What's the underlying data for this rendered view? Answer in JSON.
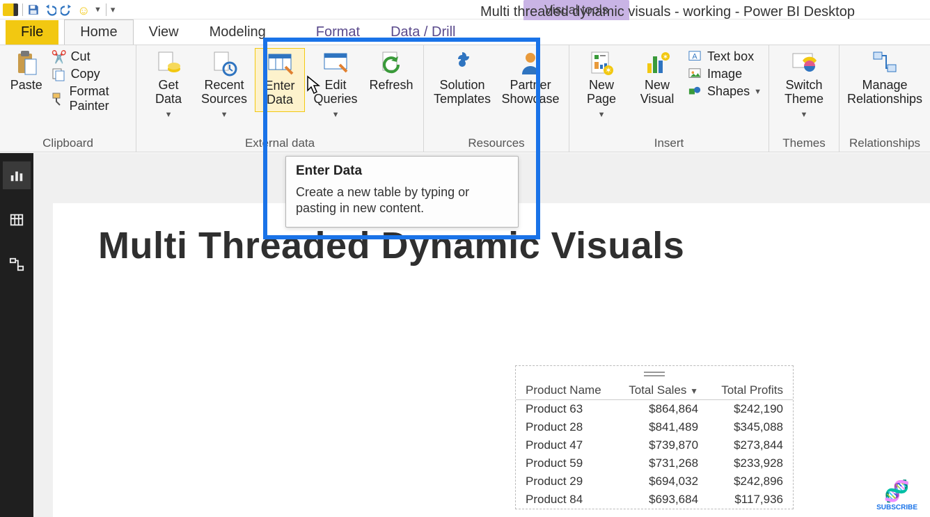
{
  "window_title": "Multi threaded dynamic visuals - working - Power BI Desktop",
  "contextual_tab_group": "Visual tools",
  "tabs": {
    "file": "File",
    "home": "Home",
    "view": "View",
    "modeling": "Modeling",
    "format": "Format",
    "data_drill": "Data / Drill"
  },
  "ribbon": {
    "clipboard": {
      "label": "Clipboard",
      "paste": "Paste",
      "cut": "Cut",
      "copy": "Copy",
      "format_painter": "Format Painter"
    },
    "external_data": {
      "label": "External data",
      "get_data": "Get\nData",
      "recent_sources": "Recent\nSources",
      "enter_data": "Enter\nData",
      "edit_queries": "Edit\nQueries",
      "refresh": "Refresh"
    },
    "resources": {
      "label": "Resources",
      "solution_templates": "Solution\nTemplates",
      "partner_showcase": "Partner\nShowcase"
    },
    "insert": {
      "label": "Insert",
      "new_page": "New\nPage",
      "new_visual": "New\nVisual",
      "text_box": "Text box",
      "image": "Image",
      "shapes": "Shapes"
    },
    "themes": {
      "label": "Themes",
      "switch_theme": "Switch\nTheme"
    },
    "relationships": {
      "label": "Relationships",
      "manage": "Manage\nRelationships"
    }
  },
  "tooltip": {
    "title": "Enter Data",
    "body": "Create a new table by typing or pasting in new content."
  },
  "canvas_title": "Multi Threaded Dynamic Visuals",
  "table": {
    "headers": {
      "name": "Product Name",
      "sales": "Total Sales",
      "profits": "Total Profits"
    },
    "rows": [
      {
        "name": "Product 63",
        "sales": "$864,864",
        "profits": "$242,190"
      },
      {
        "name": "Product 28",
        "sales": "$841,489",
        "profits": "$345,088"
      },
      {
        "name": "Product 47",
        "sales": "$739,870",
        "profits": "$273,844"
      },
      {
        "name": "Product 59",
        "sales": "$731,268",
        "profits": "$233,928"
      },
      {
        "name": "Product 29",
        "sales": "$694,032",
        "profits": "$242,896"
      },
      {
        "name": "Product 84",
        "sales": "$693,684",
        "profits": "$117,936"
      }
    ]
  },
  "subscribe": "SUBSCRIBE"
}
